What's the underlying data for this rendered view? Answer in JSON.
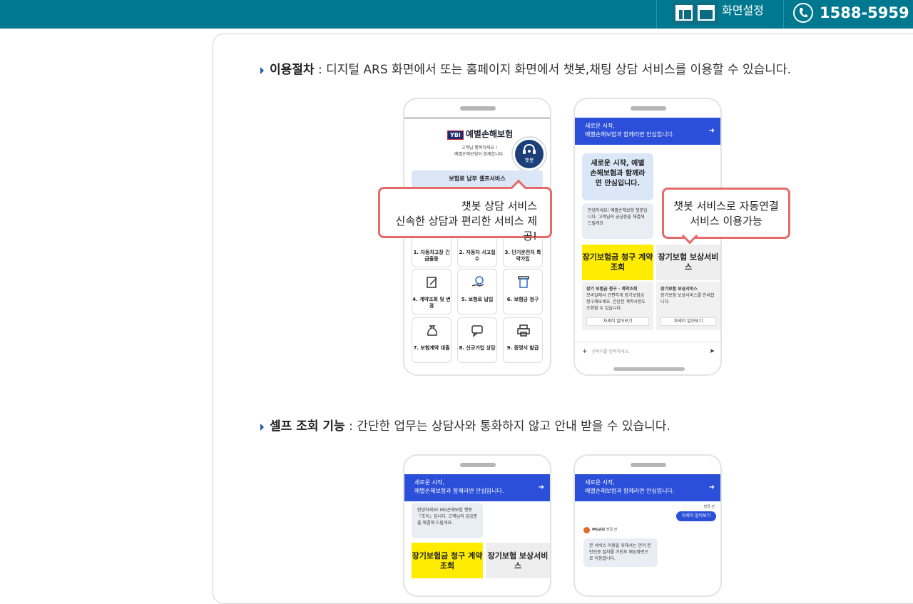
{
  "header": {
    "screen_settings_label": "화면설정",
    "phone_number": "1588-5959"
  },
  "section1": {
    "title": "이용절차",
    "description": " : 디지털 ARS 화면에서 또는 홈페이지 화면에서 챗봇,채팅 상담 서비스를 이용할 수 있습니다."
  },
  "section2": {
    "title": "셀프 조회 기능",
    "description": " : 간단한 업무는 상담사와 통화하지 않고 안내 받을 수 있습니다."
  },
  "phone1": {
    "logo": "예별손해보험",
    "greeting_1": "고객님 행복하세요 !",
    "greeting_2": "예별손해보험이 함께합니다.",
    "chatbot_label": "챗봇",
    "menu_title": "보험료 납부 셀프서비스",
    "tiles": [
      "1. 자동차고장 긴급출동",
      "2. 자동차 사고접수",
      "3. 단기운전자 특약가입",
      "4. 계약조회 및 변경",
      "5. 보험료 납입",
      "6. 보험금 청구",
      "7. 보험계약 대출",
      "8. 신규가입 상담",
      "9. 증명서 발급"
    ],
    "callout_line1": "챗봇 상담 서비스",
    "callout_line2": "신속한 상담과 편리한 서비스 제공!"
  },
  "phone2": {
    "header_line1": "새로운 시작,",
    "header_line2": "예별손해보험과 함께라면 안심입니다.",
    "big_bubble": "새로운 시작, 예별손해보험과 함께라면 안심입니다.",
    "small_bubble": "안녕하세요! 예별손해보험 챗봇입니다. 고객님의 궁금증을 해결해 드릴게요",
    "yellow_card": "장기보험금 청구 계약 조회",
    "gray_card": "장기보험 보상서비스",
    "card1_title": "장기 보험금 청구 · 계약조회",
    "card1_text": "모바일에서 간편하게 장기보험금 청구해보세요. 간단한 계약사항도 조회할 수 있습니다.",
    "card2_title": "장기보험 보상서비스",
    "card2_text": "장기보험 보상서비스를 안내합니다.",
    "more_label": "자세히 알아보기",
    "input_placeholder": "선택지를 입력하세요.",
    "callout_line1": "챗봇 서비스로 자동연결",
    "callout_line2": "서비스 이용가능"
  },
  "phone3": {
    "header_line1": "새로운 시작,",
    "header_line2": "예별손해보험과 함께라면 안심입니다.",
    "bubble": "안녕하세요! MG손해보험 챗봇 『조이』입니다. 고객님의 궁금증을 해결해 드릴게요.",
    "yellow_card": "장기보험금 청구 계약 조회",
    "gray_card": "장기보험 보상서비스"
  },
  "phone4": {
    "header_line1": "새로운 시작,",
    "header_line2": "예별손해보험과 함께라면 안심입니다.",
    "time": "방금 전",
    "user_bubble": "자세히 알아보기",
    "bot_name": "MG손보",
    "bot_time": "방금 전",
    "bot_bubble": "본 서비스 이용을 위해서는 먼저 본인인증 절차를 거친후 해당화면으로 이동합니다."
  }
}
